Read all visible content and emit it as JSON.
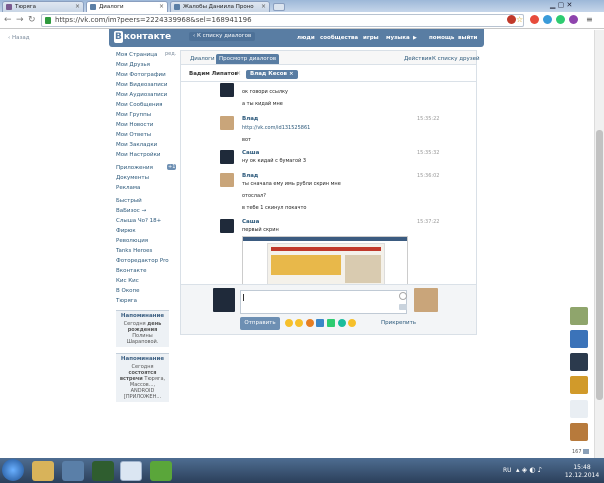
{
  "browser": {
    "tabs": [
      {
        "label": "Тюряга"
      },
      {
        "label": "Диалоги"
      },
      {
        "label": "Жалобы Даниила Проно"
      }
    ],
    "url": "https://vk.com/im?peers=2224339968&sel=168941196"
  },
  "vk": {
    "logo_letter": "В",
    "logo": "контакте",
    "back_to_list": "К списку диалогов",
    "topmenu": [
      "люди",
      "сообщества",
      "игры",
      "музыка",
      "помощь",
      "выйти"
    ],
    "back_nav": "Назад"
  },
  "leftnav": {
    "items": [
      "Моя Страница",
      "Мои Друзья",
      "Мои Фотографии",
      "Мои Видеозаписи",
      "Мои Аудиозаписи",
      "Мои Сообщения",
      "Мои Группы",
      "Мои Новости",
      "Мои Ответы",
      "Мои Закладки",
      "Мои Настройки"
    ],
    "edit": "ред.",
    "apps": [
      "Приложения",
      "Документы",
      "Реклама"
    ],
    "apps_badge": "+1",
    "links": [
      "Быстрый",
      "ВаБизос →",
      "Слыша Чо? 18+",
      "Фирюк",
      "Революция",
      "Tanks Heroes",
      "Фоторедактор Pro",
      "Вконтакте",
      "Кис Кис",
      "В Окопе",
      "Тюряга"
    ],
    "reminders": [
      {
        "title": "Напоминание",
        "l1": "Сегодня",
        "bold": "день рождения",
        "l2": "Полины Шараповой."
      },
      {
        "title": "Напоминание",
        "l1": "Сегодня",
        "bold": "состоятся встречи",
        "l2": "Тюряга, Массов..., ANDROID [ПРИЛОЖЕН..."
      }
    ]
  },
  "dialog": {
    "tabs": [
      "Диалоги",
      "Просмотр диалогов"
    ],
    "actions": [
      "Действия",
      "К списку друзей"
    ],
    "peers": [
      "Вадим Липатов",
      "Влад Кесов"
    ],
    "messages": [
      {
        "name": "",
        "time": "",
        "lines": [
          "ок говори ссылку",
          "а ты кидай мне"
        ]
      },
      {
        "name": "Влад",
        "time": "15:35:22",
        "lines": [
          "http://vk.com/id131525861",
          "вот"
        ]
      },
      {
        "name": "Саша",
        "time": "15:35:32",
        "lines": [
          "ну ок кидай с бумагой 3"
        ]
      },
      {
        "name": "Влад",
        "time": "15:36:02",
        "lines": [
          "ты сначала ему имь рубли скрин мне",
          "отослал?",
          "в тебе 1 скинул покачто"
        ]
      },
      {
        "name": "Саша",
        "time": "15:37:22",
        "lines": [
          "первый скрин"
        ]
      }
    ],
    "send": "Отправить",
    "attach": "Прикрепить"
  },
  "sidebar": {
    "count": "167"
  },
  "taskbar": {
    "lang": "RU",
    "time": "15:48",
    "date": "12.12.2014"
  }
}
